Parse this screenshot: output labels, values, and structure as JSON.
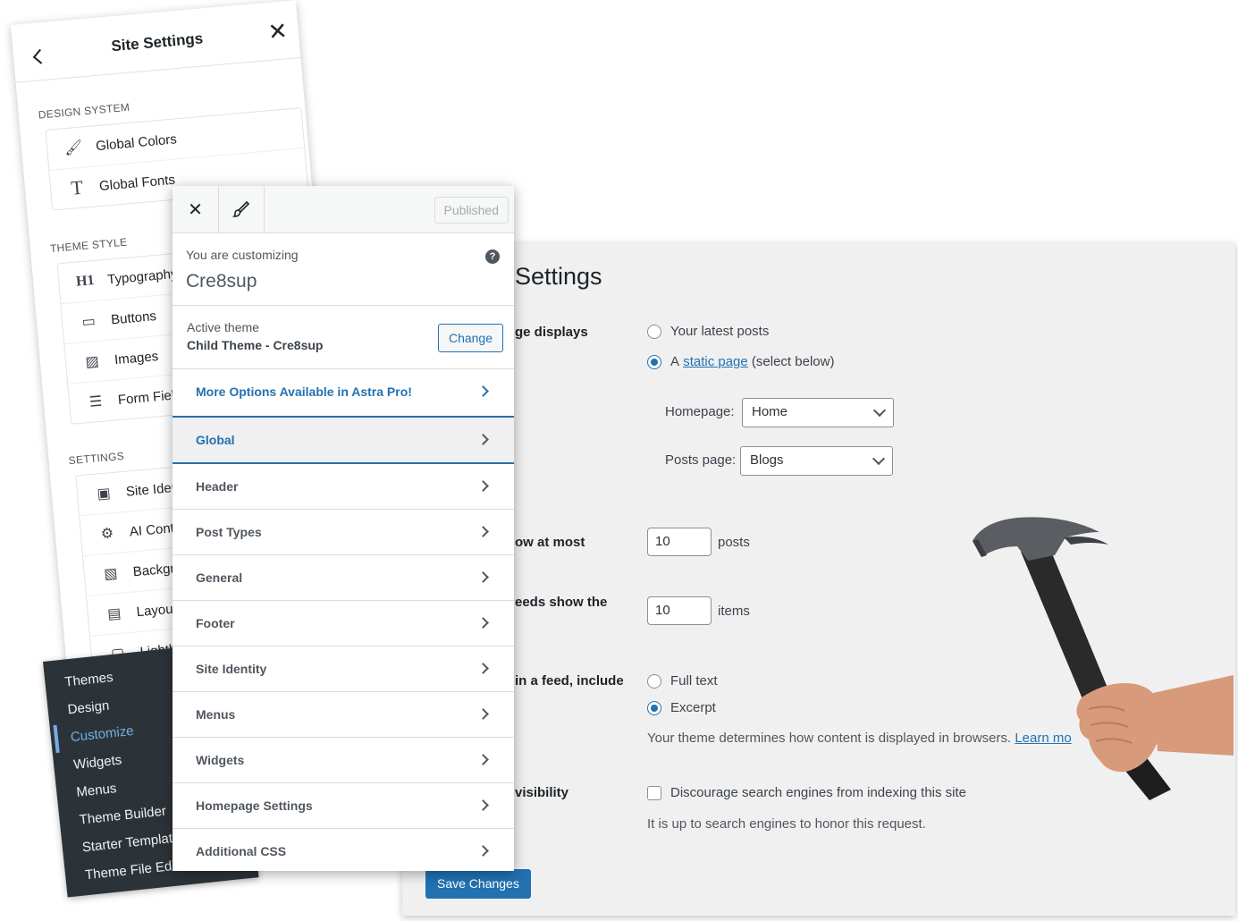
{
  "reading": {
    "title": "Settings",
    "homepage_displays_label": "ge displays",
    "latest_posts_label": "Your latest posts",
    "static_prefix": "A",
    "static_link": "static page",
    "static_suffix": "(select below)",
    "homepage_label": "Homepage:",
    "homepage_value": "Home",
    "posts_page_label": "Posts page:",
    "posts_page_value": "Blogs",
    "show_at_most_label": "ow at most",
    "show_at_most_value": "10",
    "show_at_most_unit": "posts",
    "feeds_label": "eeds show the",
    "feeds_value": "10",
    "feeds_unit": "items",
    "feed_include_label": "in a feed, include",
    "full_text_label": "Full text",
    "excerpt_label": "Excerpt",
    "theme_note": "Your theme determines how content is displayed in browsers.",
    "learn_more": "Learn mo",
    "visibility_label": "visibility",
    "discourage_label": "Discourage search engines from indexing this site",
    "honor_note": "It is up to search engines to honor this request.",
    "save_label": "Save Changes"
  },
  "site_settings": {
    "title": "Site Settings",
    "design_system_heading": "DESIGN SYSTEM",
    "global_colors": "Global Colors",
    "global_fonts": "Global Fonts",
    "theme_style_heading": "THEME STYLE",
    "typography": "Typography",
    "buttons": "Buttons",
    "images": "Images",
    "form_fields": "Form Fiel",
    "settings_heading": "SETTINGS",
    "site_identity": "Site Ider",
    "ai_context": "AI Cont",
    "background": "Backgr",
    "layout": "Layou",
    "lightbox": "Lightb"
  },
  "admin_menu": {
    "items": [
      "Themes",
      "Design",
      "Customize",
      "Widgets",
      "Menus",
      "Theme Builder",
      "Starter Templat",
      "Theme File Edit"
    ]
  },
  "customizer": {
    "published_label": "Published",
    "customizing_label": "You are customizing",
    "site_name": "Cre8sup",
    "active_theme_label": "Active theme",
    "active_theme_name": "Child Theme - Cre8sup",
    "change_label": "Change",
    "promo_label": "More Options Available in Astra Pro!",
    "sections": [
      "Global",
      "Header",
      "Post Types",
      "General",
      "Footer",
      "Site Identity",
      "Menus",
      "Widgets",
      "Homepage Settings",
      "Additional CSS"
    ]
  },
  "colors": {
    "accent": "#2271b1",
    "admin_bg": "#2c3338",
    "admin_current": "#72aee6"
  }
}
